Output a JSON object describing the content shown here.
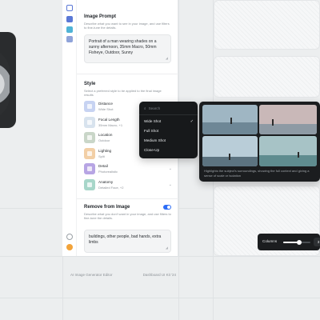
{
  "prompt": {
    "title": "Image Prompt",
    "description": "Describe what you want to see in your image, and use filters to fine-tune the details.",
    "value": "Portrait of a man wearing shades on a sunny afternoon, 35mm Macro, 50mm Fisheye, Outdoor, Sunny"
  },
  "style": {
    "title": "Style",
    "description": "Select a preferred style to be applied to the final image results",
    "rows": [
      {
        "label": "Distance",
        "value": "Wide Shot",
        "thumb_color": "#c7d3f2"
      },
      {
        "label": "Focal Length",
        "value": "35mm Macro, +1",
        "thumb_color": "#d8e3ee"
      },
      {
        "label": "Location",
        "value": "Outdoor",
        "thumb_color": "#c9d6c8"
      },
      {
        "label": "Lighting",
        "value": "Split",
        "thumb_color": "#f2cfa6"
      },
      {
        "label": "Detail",
        "value": "Photorealistic",
        "thumb_color": "#b7a5e4"
      },
      {
        "label": "Anatomy",
        "value": "Detailed Face, +2",
        "thumb_color": "#a7d6c9"
      }
    ]
  },
  "negative": {
    "title": "Remove from Image",
    "description": "Describe what you don't want in your image, and use filters to fine-tune the details.",
    "value": "buildings, other people, bad hands, extra limbs",
    "enabled": true
  },
  "dropdown": {
    "search_placeholder": "Search",
    "items": [
      "Wide Shot",
      "Full Shot",
      "Medium Shot",
      "Close-Up"
    ],
    "selected": "Wide Shot"
  },
  "preview": {
    "caption": "Highlights the subject's surroundings, showing the full context and giving a sense of scale or isolation"
  },
  "columns": {
    "label": "Columns",
    "value": "3",
    "level": 0.6
  },
  "footer": {
    "left": "AI Image Generator Editor",
    "right": "Dashboard UI Kit '24"
  },
  "colors": {
    "accent": "#2d6df6"
  }
}
